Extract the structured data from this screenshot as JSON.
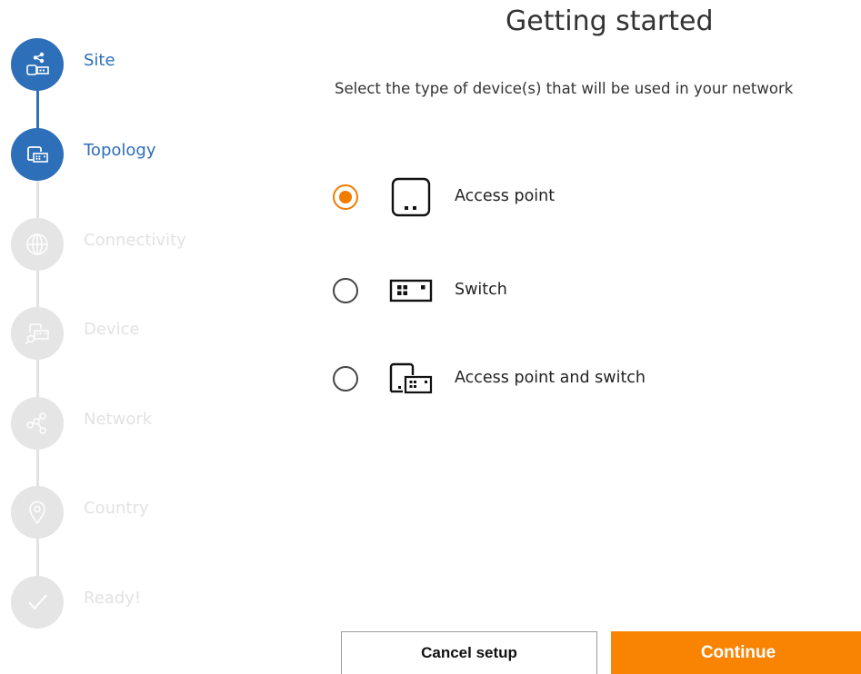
{
  "header": {
    "title": "Getting started",
    "subtitle": "Select the type of device(s) that will be used in your network"
  },
  "steps": [
    {
      "label": "Site",
      "state": "done",
      "icon": "site-network-icon"
    },
    {
      "label": "Topology",
      "state": "current",
      "icon": "topology-icon"
    },
    {
      "label": "Connectivity",
      "state": "pending",
      "icon": "globe-icon"
    },
    {
      "label": "Device",
      "state": "pending",
      "icon": "device-search-icon"
    },
    {
      "label": "Network",
      "state": "pending",
      "icon": "share-network-icon"
    },
    {
      "label": "Country",
      "state": "pending",
      "icon": "location-pin-icon"
    },
    {
      "label": "Ready!",
      "state": "pending",
      "icon": "checkmark-icon"
    }
  ],
  "options": [
    {
      "label": "Access point",
      "selected": true,
      "icon": "access-point-icon"
    },
    {
      "label": "Switch",
      "selected": false,
      "icon": "switch-icon"
    },
    {
      "label": "Access point and switch",
      "selected": false,
      "icon": "access-point-switch-icon"
    }
  ],
  "buttons": {
    "cancel": "Cancel setup",
    "continue": "Continue"
  },
  "colors": {
    "accent_blue": "#2d6fb8",
    "accent_orange": "#f98404",
    "pending_gray": "#e5e5e5"
  }
}
